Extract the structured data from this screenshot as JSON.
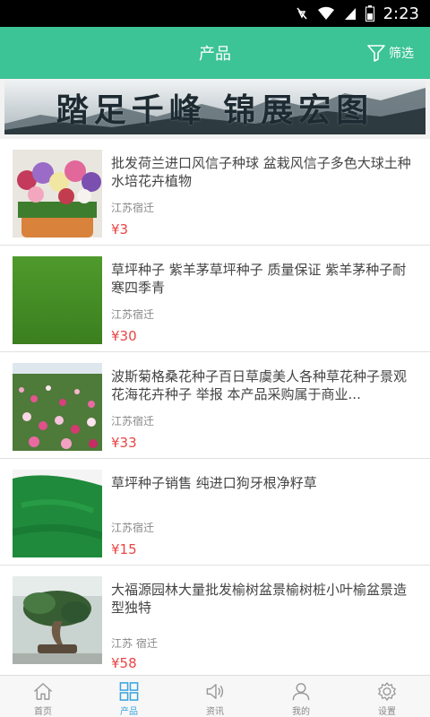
{
  "status_bar": {
    "time": "2:23"
  },
  "header": {
    "title": "产品",
    "filter_label": "筛选"
  },
  "banner": {
    "text": "踏足千峰 锦展宏图"
  },
  "products": [
    {
      "name": "批发荷兰进口风信子种球 盆栽风信子多色大球土种水培花卉植物",
      "location": "江苏宿迁",
      "price": "¥3"
    },
    {
      "name": "草坪种子 紫羊茅草坪种子 质量保证 紫羊茅种子耐寒四季青",
      "location": "江苏宿迁",
      "price": "¥30"
    },
    {
      "name": "波斯菊格桑花种子百日草虞美人各种草花种子景观花海花卉种子 举报 本产品采购属于商业...",
      "location": "江苏宿迁",
      "price": "¥33"
    },
    {
      "name": "草坪种子销售 纯进口狗牙根净籽草",
      "location": "江苏宿迁",
      "price": "¥15"
    },
    {
      "name": "大福源园林大量批发榆树盆景榆树桩小叶榆盆景造型独特",
      "location": "江苏 宿迁",
      "price": "¥58"
    }
  ],
  "bottom_nav": [
    {
      "label": "首页",
      "icon": "home-icon"
    },
    {
      "label": "产品",
      "icon": "grid-icon",
      "active": true
    },
    {
      "label": "资讯",
      "icon": "speaker-icon"
    },
    {
      "label": "我的",
      "icon": "user-icon"
    },
    {
      "label": "设置",
      "icon": "gear-icon"
    }
  ],
  "colors": {
    "header": "#3cc396",
    "price": "#e94545",
    "active_nav": "#3aa5de"
  }
}
